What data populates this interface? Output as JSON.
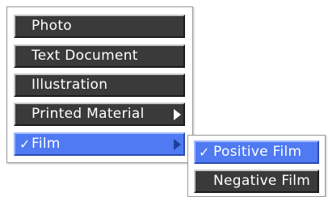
{
  "menu": {
    "items": [
      {
        "label": "Photo",
        "has_submenu": false,
        "checked": false,
        "selected": false
      },
      {
        "label": "Text Document",
        "has_submenu": false,
        "checked": false,
        "selected": false
      },
      {
        "label": "Illustration",
        "has_submenu": false,
        "checked": false,
        "selected": false
      },
      {
        "label": "Printed Material",
        "has_submenu": true,
        "checked": false,
        "selected": false
      },
      {
        "label": "Film",
        "has_submenu": true,
        "checked": true,
        "selected": true
      }
    ]
  },
  "submenu": {
    "items": [
      {
        "label": "Positive Film",
        "checked": true,
        "selected": true
      },
      {
        "label": "Negative Film",
        "checked": false,
        "selected": false
      }
    ]
  },
  "glyphs": {
    "check": "✓"
  },
  "colors": {
    "item_background": "#3a3a3a",
    "selected_background": "#4f7af2",
    "text": "#ffffff"
  }
}
